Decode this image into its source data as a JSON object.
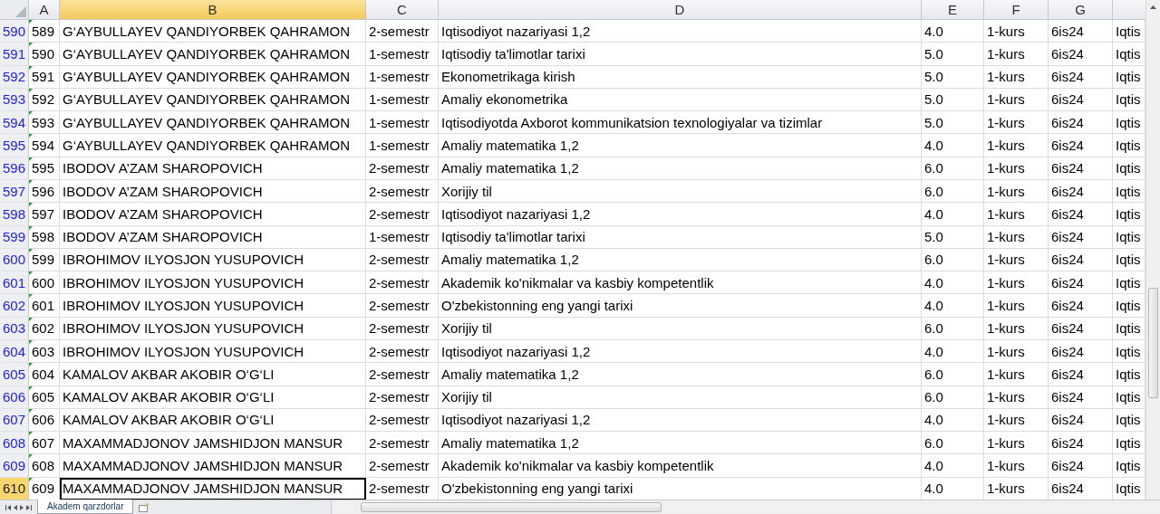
{
  "columns": [
    {
      "label": "A",
      "selected": false
    },
    {
      "label": "B",
      "selected": true
    },
    {
      "label": "C",
      "selected": false
    },
    {
      "label": "D",
      "selected": false
    },
    {
      "label": "E",
      "selected": false
    },
    {
      "label": "F",
      "selected": false
    },
    {
      "label": "G",
      "selected": false
    }
  ],
  "rows": [
    {
      "header": "590",
      "selected": false,
      "cells": [
        "589",
        "G‘AYBULLAYEV QANDIYORBEK QAHRAMON",
        "2-semestr",
        "Iqtisodiyot nazariyasi 1,2",
        "4.0",
        "1-kurs",
        "6is24",
        "Iqtis"
      ]
    },
    {
      "header": "591",
      "selected": false,
      "cells": [
        "590",
        "G‘AYBULLAYEV QANDIYORBEK QAHRAMON",
        "1-semestr",
        "Iqtisodiy ta'limotlar tarixi",
        "5.0",
        "1-kurs",
        "6is24",
        "Iqtis"
      ]
    },
    {
      "header": "592",
      "selected": false,
      "cells": [
        "591",
        "G‘AYBULLAYEV QANDIYORBEK QAHRAMON",
        "1-semestr",
        "Ekonometrikaga kirish",
        "5.0",
        "1-kurs",
        "6is24",
        "Iqtis"
      ]
    },
    {
      "header": "593",
      "selected": false,
      "cells": [
        "592",
        "G‘AYBULLAYEV QANDIYORBEK QAHRAMON",
        "1-semestr",
        "Amaliy ekonometrika",
        "5.0",
        "1-kurs",
        "6is24",
        "Iqtis"
      ]
    },
    {
      "header": "594",
      "selected": false,
      "cells": [
        "593",
        "G‘AYBULLAYEV QANDIYORBEK QAHRAMON",
        "1-semestr",
        "Iqtisodiyotda Axborot kommunikatsion texnologiyalar va tizimlar",
        "5.0",
        "1-kurs",
        "6is24",
        "Iqtis"
      ]
    },
    {
      "header": "595",
      "selected": false,
      "cells": [
        "594",
        "G‘AYBULLAYEV QANDIYORBEK QAHRAMON",
        "1-semestr",
        "Amaliy matematika 1,2",
        "4.0",
        "1-kurs",
        "6is24",
        "Iqtis"
      ]
    },
    {
      "header": "596",
      "selected": false,
      "cells": [
        "595",
        "IBODOV A’ZAM SHAROPOVICH",
        "2-semestr",
        "Amaliy matematika 1,2",
        "6.0",
        "1-kurs",
        "6is24",
        "Iqtis"
      ]
    },
    {
      "header": "597",
      "selected": false,
      "cells": [
        "596",
        "IBODOV A’ZAM SHAROPOVICH",
        "2-semestr",
        "Xorijiy til",
        "6.0",
        "1-kurs",
        "6is24",
        "Iqtis"
      ]
    },
    {
      "header": "598",
      "selected": false,
      "cells": [
        "597",
        "IBODOV A’ZAM SHAROPOVICH",
        "2-semestr",
        "Iqtisodiyot nazariyasi 1,2",
        "4.0",
        "1-kurs",
        "6is24",
        "Iqtis"
      ]
    },
    {
      "header": "599",
      "selected": false,
      "cells": [
        "598",
        "IBODOV A’ZAM SHAROPOVICH",
        "1-semestr",
        "Iqtisodiy ta'limotlar tarixi",
        "5.0",
        "1-kurs",
        "6is24",
        "Iqtis"
      ]
    },
    {
      "header": "600",
      "selected": false,
      "cells": [
        "599",
        "IBROHIMOV ILYOSJON YUSUPOVICH",
        "2-semestr",
        "Amaliy matematika 1,2",
        "6.0",
        "1-kurs",
        "6is24",
        "Iqtis"
      ]
    },
    {
      "header": "601",
      "selected": false,
      "cells": [
        "600",
        "IBROHIMOV ILYOSJON YUSUPOVICH",
        "2-semestr",
        "Akademik ko'nikmalar va kasbiy kompetentlik",
        "4.0",
        "1-kurs",
        "6is24",
        "Iqtis"
      ]
    },
    {
      "header": "602",
      "selected": false,
      "cells": [
        "601",
        "IBROHIMOV ILYOSJON YUSUPOVICH",
        "2-semestr",
        "O'zbekistonning eng yangi tarixi",
        "4.0",
        "1-kurs",
        "6is24",
        "Iqtis"
      ]
    },
    {
      "header": "603",
      "selected": false,
      "cells": [
        "602",
        "IBROHIMOV ILYOSJON YUSUPOVICH",
        "2-semestr",
        "Xorijiy til",
        "6.0",
        "1-kurs",
        "6is24",
        "Iqtis"
      ]
    },
    {
      "header": "604",
      "selected": false,
      "cells": [
        "603",
        "IBROHIMOV ILYOSJON YUSUPOVICH",
        "2-semestr",
        "Iqtisodiyot nazariyasi 1,2",
        "4.0",
        "1-kurs",
        "6is24",
        "Iqtis"
      ]
    },
    {
      "header": "605",
      "selected": false,
      "cells": [
        "604",
        "KAMALOV AKBAR AKOBIR O‘G‘LI",
        "2-semestr",
        "Amaliy matematika 1,2",
        "6.0",
        "1-kurs",
        "6is24",
        "Iqtis"
      ]
    },
    {
      "header": "606",
      "selected": false,
      "cells": [
        "605",
        "KAMALOV AKBAR AKOBIR O‘G‘LI",
        "2-semestr",
        "Xorijiy til",
        "6.0",
        "1-kurs",
        "6is24",
        "Iqtis"
      ]
    },
    {
      "header": "607",
      "selected": false,
      "cells": [
        "606",
        "KAMALOV AKBAR AKOBIR O‘G‘LI",
        "2-semestr",
        "Iqtisodiyot nazariyasi 1,2",
        "4.0",
        "1-kurs",
        "6is24",
        "Iqtis"
      ]
    },
    {
      "header": "608",
      "selected": false,
      "cells": [
        "607",
        "MAXAMMADJONOV JAMSHIDJON MANSUR",
        "2-semestr",
        "Amaliy matematika 1,2",
        "6.0",
        "1-kurs",
        "6is24",
        "Iqtis"
      ]
    },
    {
      "header": "609",
      "selected": false,
      "cells": [
        "608",
        "MAXAMMADJONOV JAMSHIDJON MANSUR",
        "2-semestr",
        "Akademik ko'nikmalar va kasbiy kompetentlik",
        "4.0",
        "1-kurs",
        "6is24",
        "Iqtis"
      ]
    },
    {
      "header": "610",
      "selected": true,
      "cells": [
        "609",
        "MAXAMMADJONOV JAMSHIDJON MANSUR",
        "2-semestr",
        "O'zbekistonning eng yangi tarixi",
        "4.0",
        "1-kurs",
        "6is24",
        "Iqtis"
      ]
    }
  ],
  "sheet_tabs": [
    {
      "label": "Akadem qarzdorlar",
      "selected": true
    }
  ]
}
